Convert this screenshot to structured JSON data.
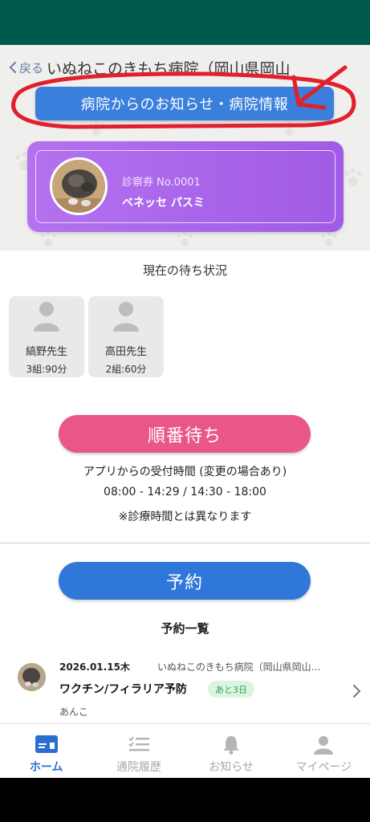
{
  "header": {
    "back_label": "戻る",
    "title": "いぬねこのきもち病院（岡山県岡山"
  },
  "info_button_label": "病院からのお知らせ・病院情報",
  "card": {
    "number": "診察券 No.0001",
    "name": "ベネッセ パスミ"
  },
  "wait_status": {
    "title": "現在の待ち状況",
    "doctors": [
      {
        "name": "縞野先生",
        "wait": "3組:90分"
      },
      {
        "name": "高田先生",
        "wait": "2組:60分"
      }
    ]
  },
  "queue_button_label": "順番待ち",
  "reception": {
    "line1": "アプリからの受付時間 (変更の場合あり)",
    "line2": "08:00 - 14:29 / 14:30 - 18:00",
    "line3": "※診療時間とは異なります"
  },
  "reserve_button_label": "予約",
  "reservation_list": {
    "title": "予約一覧",
    "items": [
      {
        "date": "2026.01.15木",
        "hospital": "いぬねこのきもち病院（岡山県岡山...",
        "vaccine": "ワクチン/フィラリア予防",
        "badge": "あと3日",
        "pet": "あんこ"
      }
    ]
  },
  "tabs": [
    {
      "label": "ホーム",
      "icon": "card-icon",
      "active": true
    },
    {
      "label": "通院履歴",
      "icon": "checklist-icon",
      "active": false
    },
    {
      "label": "お知らせ",
      "icon": "bell-icon",
      "active": false
    },
    {
      "label": "マイページ",
      "icon": "person-icon",
      "active": false
    }
  ],
  "colors": {
    "status_bar": "#005a4c",
    "info_button": "#3a7fdb",
    "card_gradient_start": "#b472ee",
    "card_gradient_end": "#a15be6",
    "queue_button": "#e9578a",
    "reserve_button": "#2f77d8",
    "annotation_red": "#e0202a",
    "tab_active": "#2a6fd0"
  }
}
